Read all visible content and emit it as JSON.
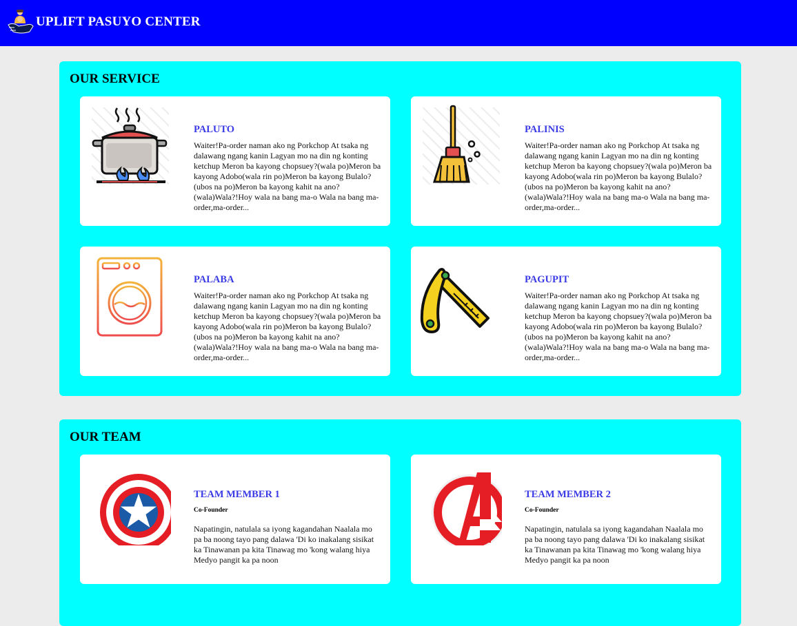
{
  "header": {
    "brand": "UPLIFT PASUYO CENTER",
    "logo_icon": "hand-holding-person-logo",
    "color": "#0000ff"
  },
  "services": {
    "title": "OUR SERVICE",
    "panel_color": "#00ffff",
    "items": [
      {
        "name": "PALUTO",
        "icon": "cooking-pot-icon",
        "description": "Waiter!Pa-order naman ako ng Porkchop At tsaka ng dalawang ngang kanin Lagyan mo na din ng konting ketchup Meron ba kayong chopsuey?(wala po)Meron ba kayong Adobo(wala rin po)Meron ba kayong Bulalo?(ubos na po)Meron ba kayong kahit na ano?(wala)Wala?!Hoy wala na bang ma-o Wala na bang ma-order,ma-order..."
      },
      {
        "name": "PALINIS",
        "icon": "broom-icon",
        "description": "Waiter!Pa-order naman ako ng Porkchop At tsaka ng dalawang ngang kanin Lagyan mo na din ng konting ketchup Meron ba kayong chopsuey?(wala po)Meron ba kayong Adobo(wala rin po)Meron ba kayong Bulalo?(ubos na po)Meron ba kayong kahit na ano?(wala)Wala?!Hoy wala na bang ma-o Wala na bang ma-order,ma-order..."
      },
      {
        "name": "PALABA",
        "icon": "washing-machine-icon",
        "description": "Waiter!Pa-order naman ako ng Porkchop At tsaka ng dalawang ngang kanin Lagyan mo na din ng konting ketchup Meron ba kayong chopsuey?(wala po)Meron ba kayong Adobo(wala rin po)Meron ba kayong Bulalo?(ubos na po)Meron ba kayong kahit na ano?(wala)Wala?!Hoy wala na bang ma-o Wala na bang ma-order,ma-order..."
      },
      {
        "name": "PAGUPIT",
        "icon": "razor-icon",
        "description": "Waiter!Pa-order naman ako ng Porkchop At tsaka ng dalawang ngang kanin Lagyan mo na din ng konting ketchup Meron ba kayong chopsuey?(wala po)Meron ba kayong Adobo(wala rin po)Meron ba kayong Bulalo?(ubos na po)Meron ba kayong kahit na ano?(wala)Wala?!Hoy wala na bang ma-o Wala na bang ma-order,ma-order..."
      }
    ]
  },
  "team": {
    "title": "OUR TEAM",
    "members": [
      {
        "name": "TEAM MEMBER 1",
        "role": "Co-Founder",
        "icon": "captain-america-shield-icon",
        "description": "Napatingin, natulala sa iyong kagandahan Naalala mo pa ba noong tayo pang dalawa 'Di ko inakalang sisikat ka Tinawanan pa kita Tinawag mo 'kong walang hiya Medyo pangit ka pa noon"
      },
      {
        "name": "TEAM MEMBER 2",
        "role": "Co-Founder",
        "icon": "avengers-logo-icon",
        "description": "Napatingin, natulala sa iyong kagandahan Naalala mo pa ba noong tayo pang dalawa 'Di ko inakalang sisikat ka Tinawanan pa kita Tinawag mo 'kong walang hiya Medyo pangit ka pa noon"
      }
    ]
  }
}
